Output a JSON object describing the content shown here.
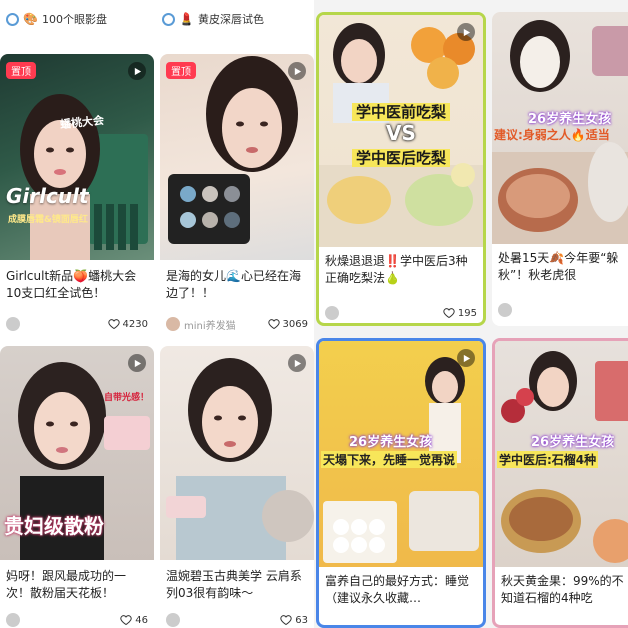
{
  "left": {
    "chips": [
      {
        "icon": "palette-icon",
        "emoji": "🎨",
        "label": "100个眼影盘"
      },
      {
        "icon": "lipstick-icon",
        "emoji": "💄",
        "label": "黄皮深唇试色"
      }
    ],
    "cards": [
      {
        "pin": "置顶",
        "overlay_main": "Girlcult",
        "overlay_sub": "成膜唇霜&镜面唇红",
        "overlay_top": "蟠桃大会",
        "title": "Girlcult新品🍑蟠桃大会 10支口红全试色！",
        "likes": "4230",
        "author": ""
      },
      {
        "pin": "置顶",
        "title": "是海的女儿🌊心已经在海边了！！",
        "likes": "3069",
        "author": "mini养发猫"
      },
      {
        "overlay_main": "贵妇级散粉",
        "overlay_top": "自带光感！",
        "title": "妈呀！跟风最成功的一次！散粉届天花板！",
        "likes": "46",
        "author": ""
      },
      {
        "title": "温婉碧玉古典美学 云肩系列03很有韵味～",
        "likes": "63",
        "author": ""
      }
    ]
  },
  "right": {
    "cards": [
      {
        "overlay_l1": "学中医前吃梨",
        "overlay_l2": "VS",
        "overlay_l3": "学中医后吃梨",
        "title": "秋燥退退退‼️学中医后3种正确吃梨法🍐",
        "likes": "195"
      },
      {
        "overlay_l1": "26岁养生女孩",
        "overlay_l2": "建议:身弱之人🔥适当",
        "title": "处暑15天🍂今年要“躲秋”！秋老虎很",
        "likes": ""
      },
      {
        "overlay_l1": "26岁养生女孩",
        "overlay_l2": "天塌下来，先睡一觉再说",
        "title": "富养自己的最好方式：睡觉（建议永久收藏…",
        "likes": ""
      },
      {
        "overlay_l1": "26岁养生女孩",
        "overlay_l2": "学中医后:石榴4种",
        "title": "秋天黄金果：99%的不知道石榴的4种吃",
        "likes": ""
      }
    ]
  },
  "colors": {
    "accent": "#ff3b50",
    "yellow": "#f7e65a",
    "green_border": "#b6d64a",
    "blue_border": "#4a86e8"
  }
}
